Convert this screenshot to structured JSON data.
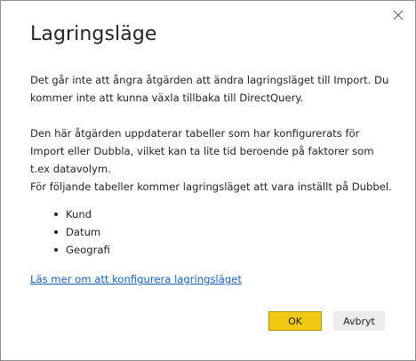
{
  "dialog": {
    "title": "Lagringsläge",
    "close_icon": "close-icon",
    "paragraphs": [
      "Det går inte att ångra åtgärden att ändra lagringsläget till Import. Du kommer inte att kunna växla tillbaka till DirectQuery.",
      "Den här åtgärden uppdaterar tabeller som har konfigurerats för Import eller Dubbla, vilket kan ta lite tid beroende på faktorer som t.ex datavolym.",
      "För följande tabeller kommer lagringsläget att vara inställt på Dubbel."
    ],
    "tables": [
      "Kund",
      "Datum",
      "Geografi"
    ],
    "link_text": "Läs mer om att konfigurera lagringsläget",
    "ok_label": "OK",
    "cancel_label": "Avbryt"
  },
  "colors": {
    "primary_button": "#f2c811",
    "link": "#1a5fb4",
    "text": "#252423",
    "secondary_button": "#ececec"
  }
}
